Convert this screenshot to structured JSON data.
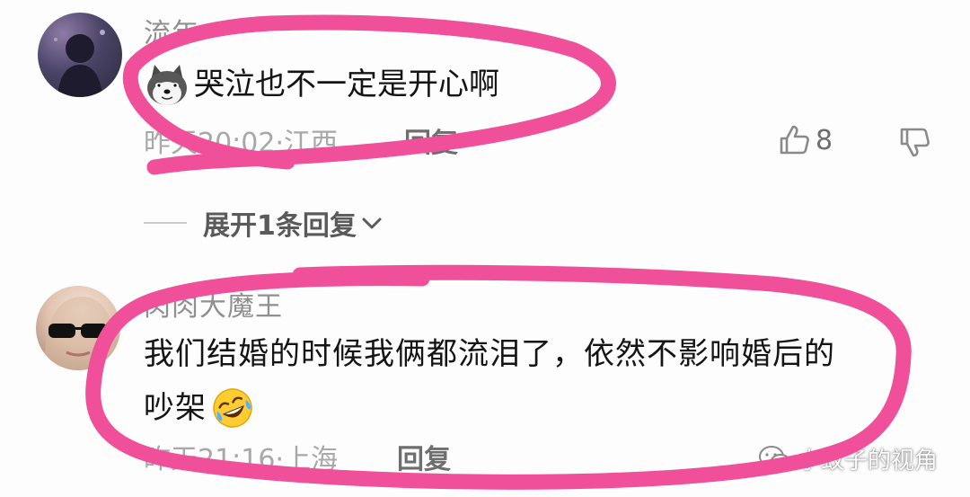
{
  "comments": [
    {
      "username": "流年",
      "emoji_icon": "shiba-dog-icon",
      "text": "哭泣也不一定是开心啊",
      "meta": "昨天20:02·江西",
      "reply_label": "回复",
      "like_count": "8",
      "expand_label": "展开1条回复"
    },
    {
      "username": "肉肉大魔王",
      "text_line1": "我们结婚的时候我俩都流泪了，依然不影响婚后的",
      "text_line2": "吵架",
      "emoji_icon": "rolling-laughing-icon",
      "meta": "昨天21:16·上海",
      "reply_label": "回复"
    }
  ],
  "watermark": {
    "icon": "wechat-icon",
    "text": "小蚊子的视角"
  },
  "colors": {
    "highlight": "#f0509a",
    "meta": "#a8a8a8",
    "username": "#8f8f8f"
  }
}
